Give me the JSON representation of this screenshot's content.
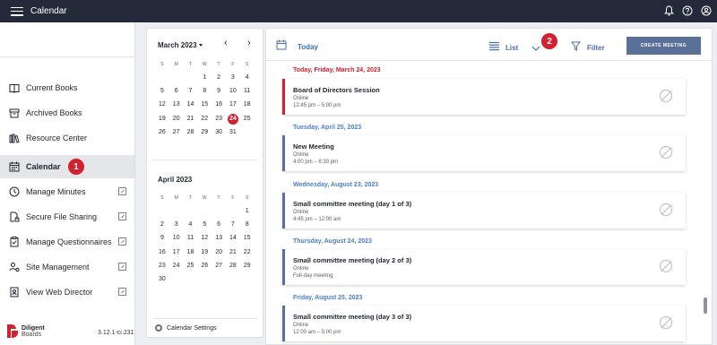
{
  "app": {
    "title": "Calendar"
  },
  "sidebar": {
    "items": [
      {
        "label": "Current Books",
        "icon": "book-icon",
        "external": false
      },
      {
        "label": "Archived Books",
        "icon": "archive-icon",
        "external": false
      },
      {
        "label": "Resource Center",
        "icon": "library-icon",
        "external": false
      },
      {
        "label": "Calendar",
        "icon": "calendar-icon",
        "external": false,
        "active": true
      },
      {
        "label": "Manage Minutes",
        "icon": "clock-icon",
        "external": true
      },
      {
        "label": "Secure File Sharing",
        "icon": "secure-file-icon",
        "external": true
      },
      {
        "label": "Manage Questionnaires",
        "icon": "checklist-icon",
        "external": true
      },
      {
        "label": "Site Management",
        "icon": "people-gear-icon",
        "external": true
      },
      {
        "label": "View Web Director",
        "icon": "id-card-icon",
        "external": true
      }
    ],
    "badge1": "1",
    "logo_line1": "Diligent",
    "logo_line2": "Boards",
    "version": "3.12.1-ci.231"
  },
  "minical": {
    "weekdays": [
      "S",
      "M",
      "T",
      "W",
      "T",
      "F",
      "S"
    ],
    "march": {
      "title": "March 2023",
      "weeks": [
        [
          "",
          "",
          "",
          "1",
          "2",
          "3",
          "4"
        ],
        [
          "5",
          "6",
          "7",
          "8",
          "9",
          "10",
          "11"
        ],
        [
          "12",
          "13",
          "14",
          "15",
          "16",
          "17",
          "18"
        ],
        [
          "19",
          "20",
          "21",
          "22",
          "23",
          "24",
          "25"
        ],
        [
          "26",
          "27",
          "28",
          "29",
          "30",
          "31",
          ""
        ]
      ],
      "today": "24"
    },
    "april": {
      "title": "April 2023",
      "weeks": [
        [
          "",
          "",
          "",
          "",
          "",
          "",
          "1"
        ],
        [
          "2",
          "3",
          "4",
          "5",
          "6",
          "7",
          "8"
        ],
        [
          "9",
          "10",
          "11",
          "12",
          "13",
          "14",
          "15"
        ],
        [
          "16",
          "17",
          "18",
          "19",
          "20",
          "21",
          "22"
        ],
        [
          "23",
          "24",
          "25",
          "26",
          "27",
          "28",
          "29"
        ],
        [
          "30",
          "",
          "",
          "",
          "",
          "",
          ""
        ]
      ]
    },
    "prev_arrow": "‹",
    "next_arrow": "›",
    "settings_label": "Calendar Settings"
  },
  "toolbar": {
    "today_label": "Today",
    "view_label": "List",
    "badge2": "2",
    "filter_label": "Filter",
    "create_label": "CREATE MEETING"
  },
  "feed": [
    {
      "date": "Today, Friday, March 24, 2023",
      "today": true,
      "title": "Board of Directors Session",
      "line1": "Online",
      "line2": "12:45 pm – 5:00 pm"
    },
    {
      "date": "Tuesday, April 25, 2023",
      "today": false,
      "title": "New Meeting",
      "line1": "Online",
      "line2": "4:00 pm – 6:30 pm"
    },
    {
      "date": "Wednesday, August 23, 2023",
      "today": false,
      "title": "Small committee meeting (day 1 of 3)",
      "line1": "Online",
      "line2": "4:45 pm – 12:00 am"
    },
    {
      "date": "Thursday, August 24, 2023",
      "today": false,
      "title": "Small committee meeting (day 2 of 3)",
      "line1": "Online",
      "line2": "Full-day meeting"
    },
    {
      "date": "Friday, August 25, 2023",
      "today": false,
      "title": "Small committee meeting (day 3 of 3)",
      "line1": "Online",
      "line2": "12:00 am – 5:00 pm"
    }
  ],
  "colors": {
    "accent": "#d3202f",
    "topbar": "#232b3a",
    "primary_button": "#5b7096",
    "link": "#4a7fc8"
  }
}
